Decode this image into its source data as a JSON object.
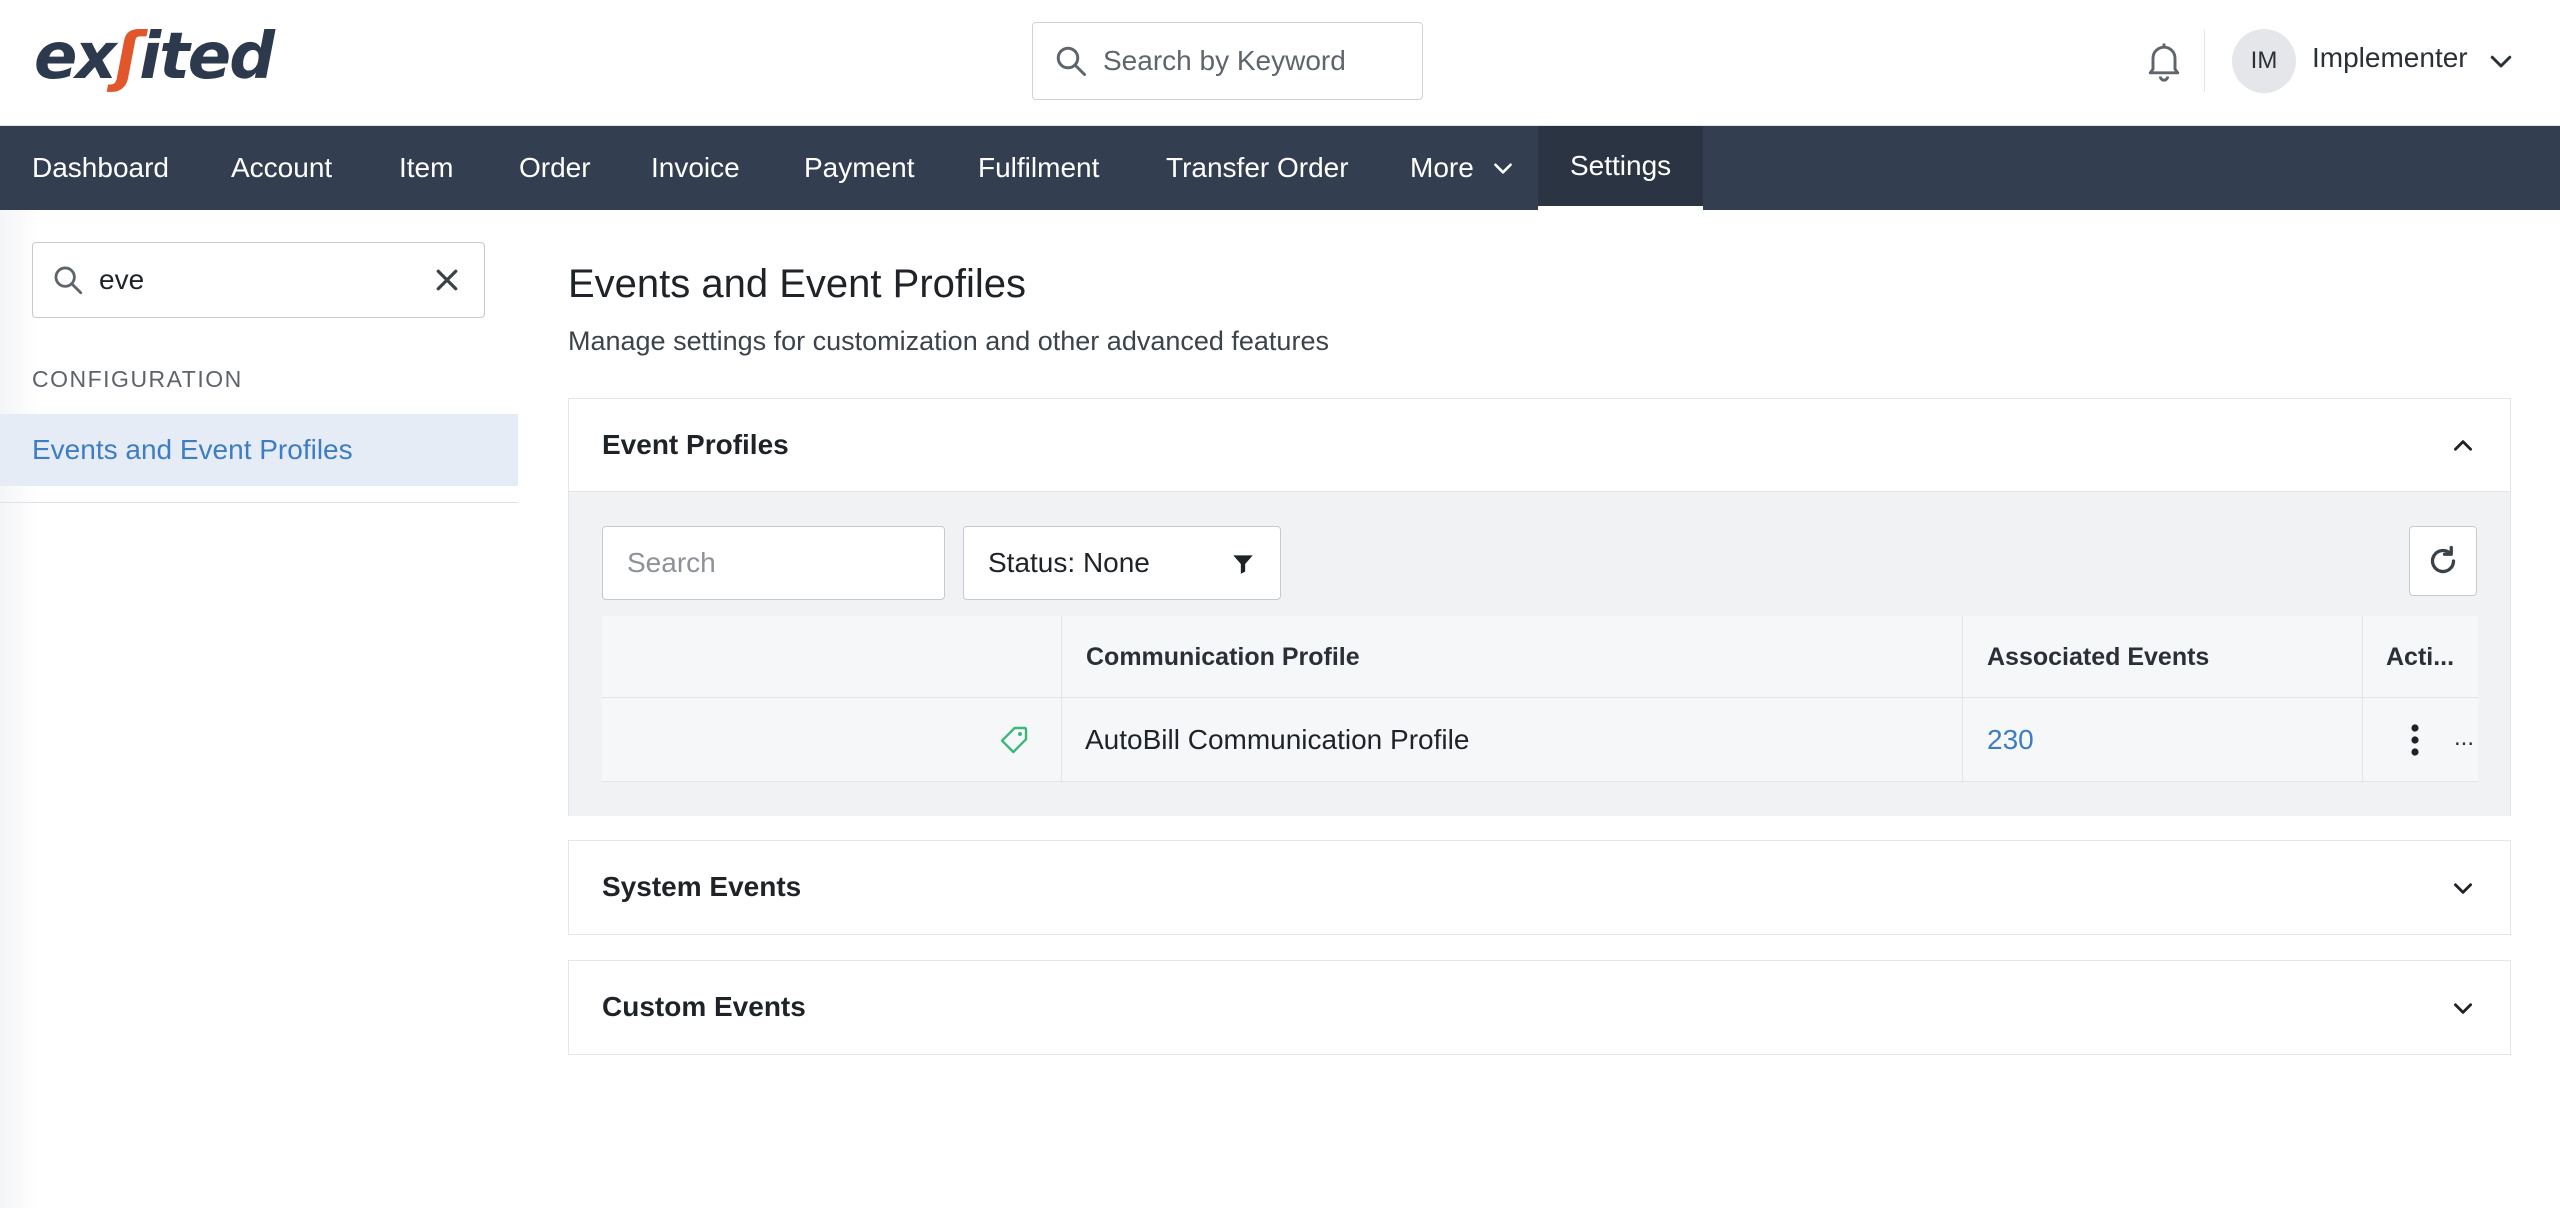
{
  "header": {
    "logo_part1": "ex",
    "logo_part2": "ited",
    "search_placeholder": "Search by Keyword",
    "user_initials": "IM",
    "user_name": "Implementer"
  },
  "nav": {
    "items": [
      "Dashboard",
      "Account",
      "Item",
      "Order",
      "Invoice",
      "Payment",
      "Fulfilment",
      "Transfer Order",
      "More",
      "Settings"
    ],
    "active": "Settings"
  },
  "sidebar": {
    "search_value": "eve",
    "section_label": "CONFIGURATION",
    "items": [
      {
        "label": "Events and Event Profiles",
        "selected": true
      }
    ]
  },
  "main": {
    "title": "Events and Event Profiles",
    "subtitle": "Manage settings for customization and other advanced features",
    "panels": [
      {
        "title": "Event Profiles",
        "expanded": true,
        "search_placeholder": "Search",
        "status_filter": "Status: None",
        "columns": [
          "Communication Profile",
          "Associated Events",
          "Acti..."
        ],
        "rows": [
          {
            "communication_profile": "AutoBill Communication Profile",
            "associated_events": "230",
            "actions_overflow": "..."
          }
        ]
      },
      {
        "title": "System Events",
        "expanded": false
      },
      {
        "title": "Custom Events",
        "expanded": false
      }
    ]
  },
  "colors": {
    "nav_bg": "#333f50",
    "link": "#3d7ec2",
    "logo_dark": "#2d3a4d",
    "logo_accent": "#e1572b",
    "tag_icon": "#3cb77a"
  },
  "icons": [
    "search-icon",
    "bell-icon",
    "chevron-down-icon",
    "close-icon",
    "filter-icon",
    "refresh-icon",
    "tag-icon",
    "kebab-icon",
    "chevron-up-icon"
  ]
}
